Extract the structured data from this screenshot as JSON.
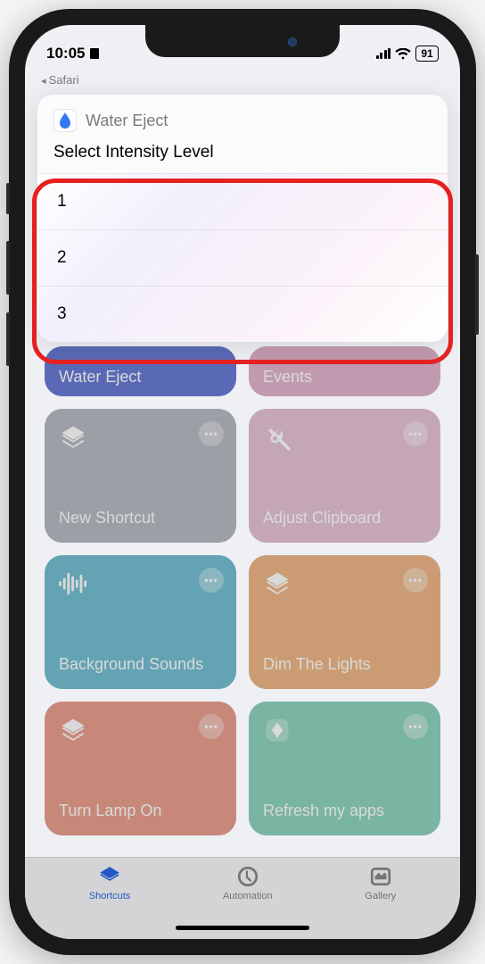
{
  "status_bar": {
    "time": "10:05",
    "battery": "91"
  },
  "back_link": "Safari",
  "modal": {
    "app_name": "Water Eject",
    "prompt": "Select Intensity Level",
    "options": [
      "1",
      "2",
      "3"
    ]
  },
  "shortcuts": {
    "row0": [
      {
        "label": "Water Eject"
      },
      {
        "label": "Events"
      }
    ],
    "tiles": [
      {
        "label": "New Shortcut",
        "color": "gray",
        "icon": "layers"
      },
      {
        "label": "Adjust Clipboard",
        "color": "lightpink",
        "icon": "scissors"
      },
      {
        "label": "Background Sounds",
        "color": "teal",
        "icon": "waveform"
      },
      {
        "label": "Dim The Lights",
        "color": "orange",
        "icon": "layers"
      },
      {
        "label": "Turn Lamp On",
        "color": "coral",
        "icon": "layers"
      },
      {
        "label": "Refresh my apps",
        "color": "mint",
        "icon": "diamond"
      }
    ]
  },
  "tabs": {
    "shortcuts": "Shortcuts",
    "automation": "Automation",
    "gallery": "Gallery"
  }
}
